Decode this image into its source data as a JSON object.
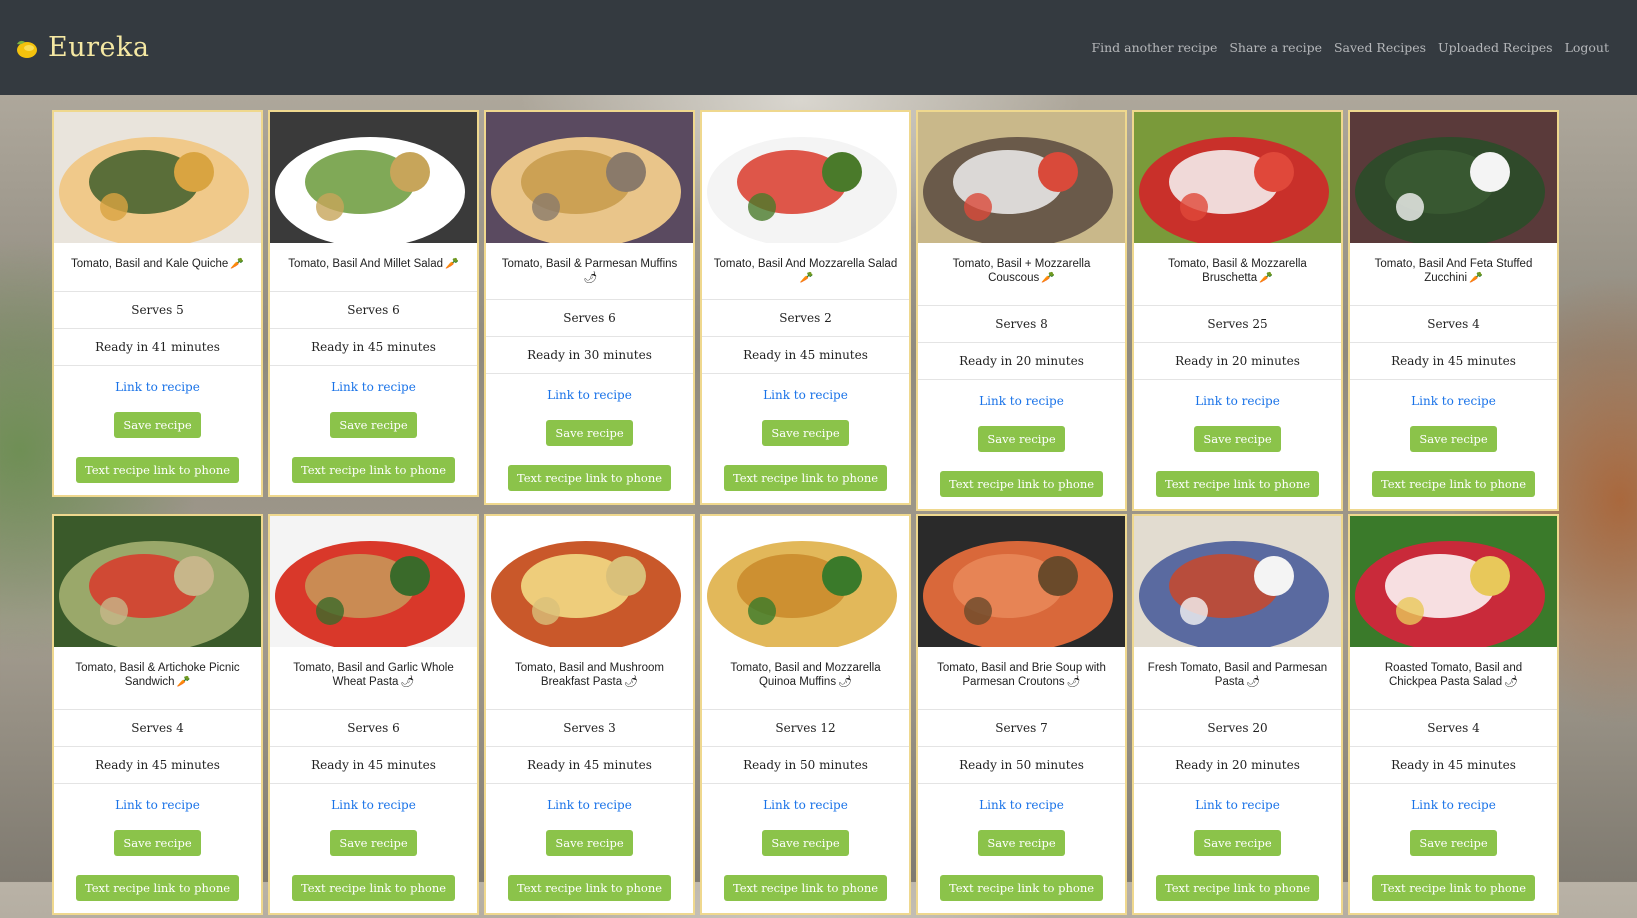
{
  "brand": {
    "name": "Eureka",
    "logo_icon": "lemon-icon"
  },
  "nav": [
    "Find another recipe",
    "Share a recipe",
    "Saved Recipes",
    "Uploaded Recipes",
    "Logout"
  ],
  "card_labels": {
    "link": "Link to recipe",
    "save": "Save recipe",
    "text": "Text recipe link to phone"
  },
  "colors": {
    "navbar": "#343a40",
    "brand": "#f5e8a3",
    "button": "#8bc34a",
    "link": "#1a73e8",
    "card_border": "#efd88e"
  },
  "rows": [
    [
      {
        "title": "Tomato, Basil and Kale Quiche",
        "badge": "carrot",
        "serves": "Serves 5",
        "ready": "Ready in 41 minutes"
      },
      {
        "title": "Tomato, Basil And Millet Salad",
        "badge": "carrot",
        "serves": "Serves 6",
        "ready": "Ready in 45 minutes"
      },
      {
        "title": "Tomato, Basil & Parmesan Muffins",
        "badge": "pepper",
        "serves": "Serves 6",
        "ready": "Ready in 30 minutes"
      },
      {
        "title": "Tomato, Basil And Mozzarella Salad",
        "badge": "carrot",
        "serves": "Serves 2",
        "ready": "Ready in 45 minutes"
      },
      {
        "title": "Tomato, Basil + Mozzarella Couscous",
        "badge": "carrot",
        "serves": "Serves 8",
        "ready": "Ready in 20 minutes"
      },
      {
        "title": "Tomato, Basil & Mozzarella Bruschetta",
        "badge": "carrot",
        "serves": "Serves 25",
        "ready": "Ready in 20 minutes"
      },
      {
        "title": "Tomato, Basil And Feta Stuffed Zucchini",
        "badge": "carrot",
        "serves": "Serves 4",
        "ready": "Ready in 45 minutes"
      }
    ],
    [
      {
        "title": "Tomato, Basil & Artichoke Picnic Sandwich",
        "badge": "carrot",
        "serves": "Serves 4",
        "ready": "Ready in 45 minutes"
      },
      {
        "title": "Tomato, Basil and Garlic Whole Wheat Pasta",
        "badge": "pepper",
        "serves": "Serves 6",
        "ready": "Ready in 45 minutes"
      },
      {
        "title": "Tomato, Basil and Mushroom Breakfast Pasta",
        "badge": "pepper",
        "serves": "Serves 3",
        "ready": "Ready in 45 minutes"
      },
      {
        "title": "Tomato, Basil and Mozzarella Quinoa Muffins",
        "badge": "pepper",
        "serves": "Serves 12",
        "ready": "Ready in 50 minutes"
      },
      {
        "title": "Tomato, Basil and Brie Soup with Parmesan Croutons",
        "badge": "pepper",
        "serves": "Serves 7",
        "ready": "Ready in 50 minutes"
      },
      {
        "title": "Fresh Tomato, Basil and Parmesan Pasta",
        "badge": "pepper",
        "serves": "Serves 20",
        "ready": "Ready in 20 minutes"
      },
      {
        "title": "Roasted Tomato, Basil and Chickpea Pasta Salad",
        "badge": "pepper",
        "serves": "Serves 4",
        "ready": "Ready in 45 minutes"
      }
    ]
  ]
}
